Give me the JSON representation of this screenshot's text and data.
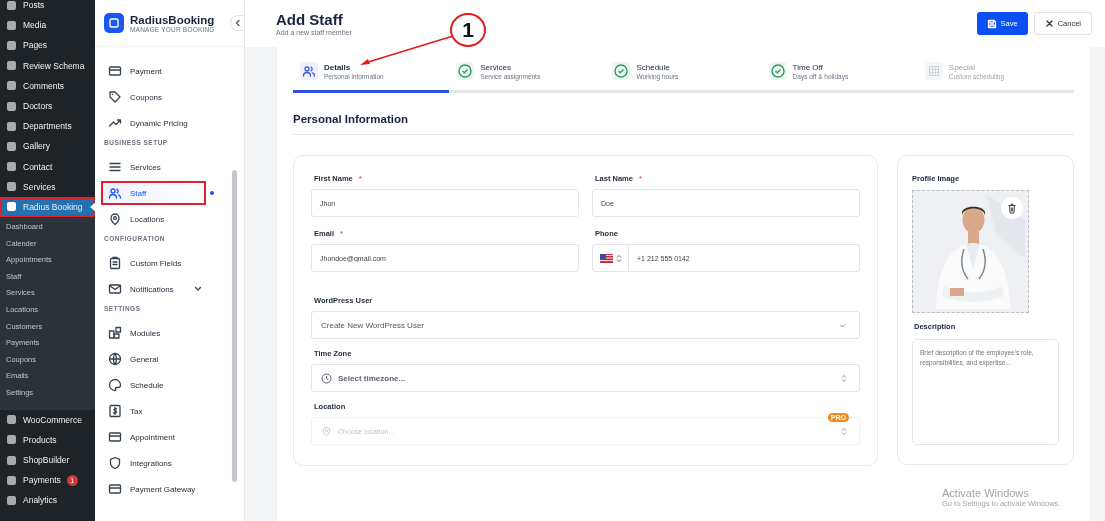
{
  "wp_menu": {
    "items": [
      {
        "label": "Posts",
        "selected": false
      },
      {
        "label": "Media",
        "selected": false
      },
      {
        "label": "Pages",
        "selected": false
      },
      {
        "label": "Review Schema",
        "selected": false
      },
      {
        "label": "Comments",
        "selected": false
      },
      {
        "label": "Doctors",
        "selected": false
      },
      {
        "label": "Departments",
        "selected": false
      },
      {
        "label": "Gallery",
        "selected": false
      },
      {
        "label": "Contact",
        "selected": false
      },
      {
        "label": "Services",
        "selected": false
      },
      {
        "label": "Radius Booking",
        "selected": true,
        "highlighted": true,
        "children": [
          {
            "label": "Dashboard"
          },
          {
            "label": "Calender"
          },
          {
            "label": "Appointments"
          },
          {
            "label": "Staff"
          },
          {
            "label": "Services"
          },
          {
            "label": "Locations"
          },
          {
            "label": "Customers"
          },
          {
            "label": "Payments"
          },
          {
            "label": "Coupons"
          },
          {
            "label": "Emails"
          },
          {
            "label": "Settings"
          }
        ]
      },
      {
        "label": "WooCommerce",
        "selected": false
      },
      {
        "label": "Products",
        "selected": false
      },
      {
        "label": "ShopBuilder",
        "selected": false
      },
      {
        "label": "Payments",
        "selected": false,
        "badge": "1"
      },
      {
        "label": "Analytics",
        "selected": false
      }
    ]
  },
  "plugin_sidebar": {
    "brand": "RadiusBooking",
    "tagline": "MANAGE YOUR BOOKING",
    "items": [
      {
        "kind": "item",
        "label": "Payment",
        "selected": false
      },
      {
        "kind": "item",
        "label": "Coupons",
        "selected": false
      },
      {
        "kind": "item",
        "label": "Dynamic Pricing",
        "selected": false
      },
      {
        "kind": "heading",
        "label": "BUSINESS SETUP"
      },
      {
        "kind": "item",
        "label": "Services",
        "selected": false
      },
      {
        "kind": "item",
        "label": "Staff",
        "selected": true,
        "highlighted": true
      },
      {
        "kind": "item",
        "label": "Locations",
        "selected": false
      },
      {
        "kind": "heading",
        "label": "CONFIGURATION"
      },
      {
        "kind": "item",
        "label": "Custom Fields",
        "selected": false
      },
      {
        "kind": "item",
        "label": "Notifications",
        "selected": false,
        "expandable": true
      },
      {
        "kind": "heading",
        "label": "SETTINGS"
      },
      {
        "kind": "item",
        "label": "Modules",
        "selected": false
      },
      {
        "kind": "item",
        "label": "General",
        "selected": false
      },
      {
        "kind": "item",
        "label": "Schedule",
        "selected": false
      },
      {
        "kind": "item",
        "label": "Tax",
        "selected": false
      },
      {
        "kind": "item",
        "label": "Appointment",
        "selected": false
      },
      {
        "kind": "item",
        "label": "Integrations",
        "selected": false
      },
      {
        "kind": "item",
        "label": "Payment Gateway",
        "selected": false
      }
    ]
  },
  "header": {
    "title": "Add Staff",
    "subtitle": "Add a new staff member",
    "buttons": [
      {
        "kind": "primary",
        "label": "Save"
      },
      {
        "kind": "secondary",
        "label": "Cancel"
      }
    ]
  },
  "callout": {
    "text": "1"
  },
  "steps": [
    {
      "title": "Details",
      "subtitle": "Personal information",
      "selected": true,
      "completed": false,
      "disabled": false
    },
    {
      "title": "Services",
      "subtitle": "Service assignments",
      "selected": false,
      "completed": true,
      "disabled": false
    },
    {
      "title": "Schedule",
      "subtitle": "Working hours",
      "selected": false,
      "completed": true,
      "disabled": false
    },
    {
      "title": "Time Off",
      "subtitle": "Days off & holidays",
      "selected": false,
      "completed": true,
      "disabled": false
    },
    {
      "title": "Special",
      "subtitle": "Custom scheduling",
      "selected": false,
      "completed": false,
      "disabled": true
    }
  ],
  "section_title": "Personal Information",
  "form": {
    "fields": [
      {
        "kind": "text",
        "label": "First Name",
        "required_mark": "*",
        "value": "Jhon"
      },
      {
        "kind": "text",
        "label": "Last Name",
        "required_mark": "*",
        "value": "Doe"
      },
      {
        "kind": "text",
        "label": "Email",
        "required_mark": "*",
        "value": "Jhondoe@gmail.com"
      },
      {
        "kind": "phone",
        "label": "Phone",
        "value": "+1 212 555 0142"
      },
      {
        "kind": "select",
        "label": "WordPress User",
        "value": "Create New WordPress User"
      },
      {
        "kind": "timezone",
        "label": "Time Zone",
        "placeholder": "Select timezone..."
      },
      {
        "kind": "location",
        "label": "Location",
        "placeholder": "Choose location...",
        "badge": "PRO",
        "disabled": true
      }
    ]
  },
  "profile": {
    "image_label": "Profile Image",
    "description_label": "Description",
    "description_placeholder": "Brief description of the employee's role, responsibilities, and expertise..."
  },
  "os_notice": {
    "title": "Activate Windows",
    "text": "Go to Settings to activate Windows."
  }
}
